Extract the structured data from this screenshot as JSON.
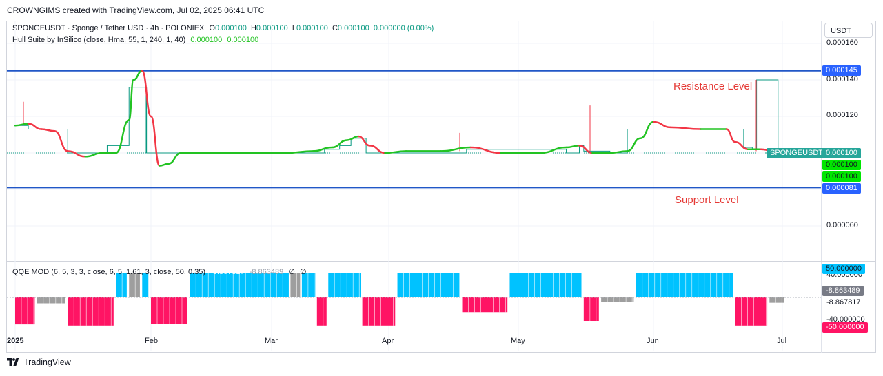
{
  "header": {
    "text": "CROWNGIMS created with TradingView.com, Jul 02, 2025 06:41 UTC"
  },
  "legend": {
    "line1": {
      "symbol": "SPONGEUSDT · Sponge / Tether USD · 4h · POLONIEX",
      "o_label": "O",
      "o_value": "0.000100",
      "h_label": "H",
      "h_value": "0.000100",
      "l_label": "L",
      "l_value": "0.000100",
      "c_label": "C",
      "c_value": "0.000100",
      "change": "0.000000 (0.00%)"
    },
    "line2": {
      "name": "Hull Suite by InSilico (close, Hma, 55, 1, 240, 1, 40)",
      "v1": "0.000100",
      "v2": "0.000100"
    },
    "qqe": {
      "name": "QQE MOD (6, 5, 3, 3, close, 6, 5, 1.61, 3, close, 50, 0.35)",
      "v1": "-8.867817",
      "v2": "-8.863489",
      "v3": "∅",
      "v4": "∅"
    }
  },
  "currency_button": "USDT",
  "price_axis": [
    "0.000160",
    "0.000140",
    "0.000120",
    "0.000060"
  ],
  "price_tags": {
    "resistance": "0.000145",
    "current_symbol": "SPONGEUSDT",
    "current": "0.000100",
    "hull1": "0.000100",
    "hull2": "0.000100",
    "support": "0.000081"
  },
  "annotations": {
    "resistance": "Resistance Level",
    "support": "Support Level"
  },
  "qqe_axis": {
    "top": "40.000000",
    "bottom": "-40.000000"
  },
  "qqe_tags": {
    "upper": "50.000000",
    "value1": "-8.863489",
    "value2": "-8.867817",
    "lower": "-50.000000"
  },
  "time_axis": [
    "2025",
    "Feb",
    "Mar",
    "Apr",
    "May",
    "Jun",
    "Jul"
  ],
  "footer": {
    "brand": "TradingView"
  },
  "colors": {
    "level_line": "#2157c7",
    "hull_up": "#22c322",
    "hull_down": "#f23645",
    "step_line": "#089981",
    "qqe_blue": "#00c2ff",
    "qqe_red": "#ff1464",
    "qqe_gray": "#9e9e9e",
    "resistance_text": "#e53935"
  },
  "chart_data": [
    {
      "type": "line",
      "title": "SPONGEUSDT · Sponge / Tether USD · 4h · POLONIEX",
      "x_axis": [
        "2025",
        "Feb",
        "Mar",
        "Apr",
        "May",
        "Jun",
        "Jul"
      ],
      "yticks": [
        "0.000160",
        "0.000140",
        "0.000120",
        "0.000060"
      ],
      "ylim": [
        4.6e-05,
        0.000166
      ],
      "horizontal_levels": [
        {
          "name": "Resistance Level",
          "value": 0.000145
        },
        {
          "name": "Support Level",
          "value": 8.1e-05
        }
      ],
      "series": [
        {
          "name": "Hull Suite by InSilico",
          "x": [
            "2025-01-01",
            "2025-01-04",
            "2025-01-07",
            "2025-01-10",
            "2025-01-13",
            "2025-01-17",
            "2025-01-21",
            "2025-01-24",
            "2025-01-27",
            "2025-01-28",
            "2025-01-30",
            "2025-02-01",
            "2025-02-03",
            "2025-02-05",
            "2025-02-08",
            "2025-02-15",
            "2025-02-25",
            "2025-03-05",
            "2025-03-12",
            "2025-03-17",
            "2025-03-21",
            "2025-03-24",
            "2025-03-27",
            "2025-03-31",
            "2025-04-05",
            "2025-04-13",
            "2025-04-20",
            "2025-04-27",
            "2025-05-06",
            "2025-05-12",
            "2025-05-15",
            "2025-05-18",
            "2025-05-22",
            "2025-05-26",
            "2025-05-29",
            "2025-06-01",
            "2025-06-05",
            "2025-06-12",
            "2025-06-18",
            "2025-06-20",
            "2025-06-23",
            "2025-06-26",
            "2025-06-30"
          ],
          "values": [
            0.000115,
            0.000116,
            0.000113,
            0.000112,
            0.000101,
            9.8e-05,
            0.0001,
            0.0001,
            0.000118,
            0.00014,
            0.000145,
            0.00012,
            9.3e-05,
            9.4e-05,
            0.0001,
            0.0001,
            0.0001,
            0.0001,
            0.000101,
            0.000103,
            0.000107,
            0.000109,
            0.000104,
            0.0001,
            0.000101,
            0.000101,
            0.000103,
            0.0001,
            0.0001,
            0.000103,
            0.000104,
            0.0001,
            0.0001,
            0.000101,
            0.000108,
            0.000117,
            0.000114,
            0.000113,
            0.000113,
            0.000106,
            0.000102,
            0.000102,
            0.0001
          ]
        },
        {
          "name": "Price (4h)",
          "x": [
            "2025-01-01",
            "2025-01-04",
            "2025-01-10",
            "2025-01-13",
            "2025-01-22",
            "2025-01-27",
            "2025-01-31",
            "2025-02-28",
            "2025-03-15",
            "2025-03-19",
            "2025-03-22",
            "2025-03-26",
            "2025-04-18",
            "2025-04-19",
            "2025-05-12",
            "2025-05-15",
            "2025-05-16",
            "2025-05-22",
            "2025-05-26",
            "2025-06-18",
            "2025-06-22",
            "2025-06-24",
            "2025-06-25",
            "2025-06-30"
          ],
          "values": [
            0.000115,
            0.000113,
            0.000113,
            0.0001,
            0.000104,
            0.000136,
            0.0001,
            0.0001,
            0.000102,
            0.000104,
            0.000108,
            0.0001,
            0.0001,
            0.000102,
            0.0001,
            0.000104,
            0.000101,
            0.0001,
            0.000113,
            0.000113,
            0.000103,
            0.000102,
            0.00014,
            0.0001
          ]
        }
      ]
    },
    {
      "type": "bar",
      "title": "QQE MOD (6, 5, 3, 3, close, 6, 5, 1.61, 3, close, 50, 0.35)",
      "yticks": [
        "40.000000",
        "-40.000000"
      ],
      "ylim": [
        -50,
        50
      ],
      "segments": [
        {
          "from": "2025-01-01",
          "to": "2025-01-05",
          "value": -46,
          "color": "red"
        },
        {
          "from": "2025-01-06",
          "to": "2025-01-12",
          "value": -10,
          "color": "gray"
        },
        {
          "from": "2025-01-13",
          "to": "2025-01-23",
          "value": -48,
          "color": "red"
        },
        {
          "from": "2025-01-24",
          "to": "2025-01-26",
          "value": 42,
          "color": "blue"
        },
        {
          "from": "2025-01-27",
          "to": "2025-01-29",
          "value": 42,
          "color": "gray"
        },
        {
          "from": "2025-01-30",
          "to": "2025-01-31",
          "value": 42,
          "color": "blue"
        },
        {
          "from": "2025-02-01",
          "to": "2025-02-09",
          "value": -45,
          "color": "red"
        },
        {
          "from": "2025-02-10",
          "to": "2025-03-05",
          "value": 42,
          "color": "blue"
        },
        {
          "from": "2025-03-06",
          "to": "2025-03-08",
          "value": 42,
          "color": "gray"
        },
        {
          "from": "2025-03-09",
          "to": "2025-03-12",
          "value": 42,
          "color": "blue"
        },
        {
          "from": "2025-03-13",
          "to": "2025-03-15",
          "value": -48,
          "color": "red"
        },
        {
          "from": "2025-03-16",
          "to": "2025-03-24",
          "value": 42,
          "color": "blue"
        },
        {
          "from": "2025-03-25",
          "to": "2025-04-02",
          "value": -48,
          "color": "red"
        },
        {
          "from": "2025-04-03",
          "to": "2025-04-17",
          "value": 42,
          "color": "blue"
        },
        {
          "from": "2025-04-18",
          "to": "2025-04-28",
          "value": -25,
          "color": "red"
        },
        {
          "from": "2025-04-29",
          "to": "2025-05-15",
          "value": 42,
          "color": "blue"
        },
        {
          "from": "2025-05-16",
          "to": "2025-05-19",
          "value": -40,
          "color": "red"
        },
        {
          "from": "2025-05-20",
          "to": "2025-05-27",
          "value": -8,
          "color": "gray"
        },
        {
          "from": "2025-05-28",
          "to": "2025-06-19",
          "value": 42,
          "color": "blue"
        },
        {
          "from": "2025-06-20",
          "to": "2025-06-27",
          "value": -48,
          "color": "red"
        },
        {
          "from": "2025-06-28",
          "to": "2025-07-01",
          "value": -9,
          "color": "gray"
        }
      ]
    }
  ]
}
